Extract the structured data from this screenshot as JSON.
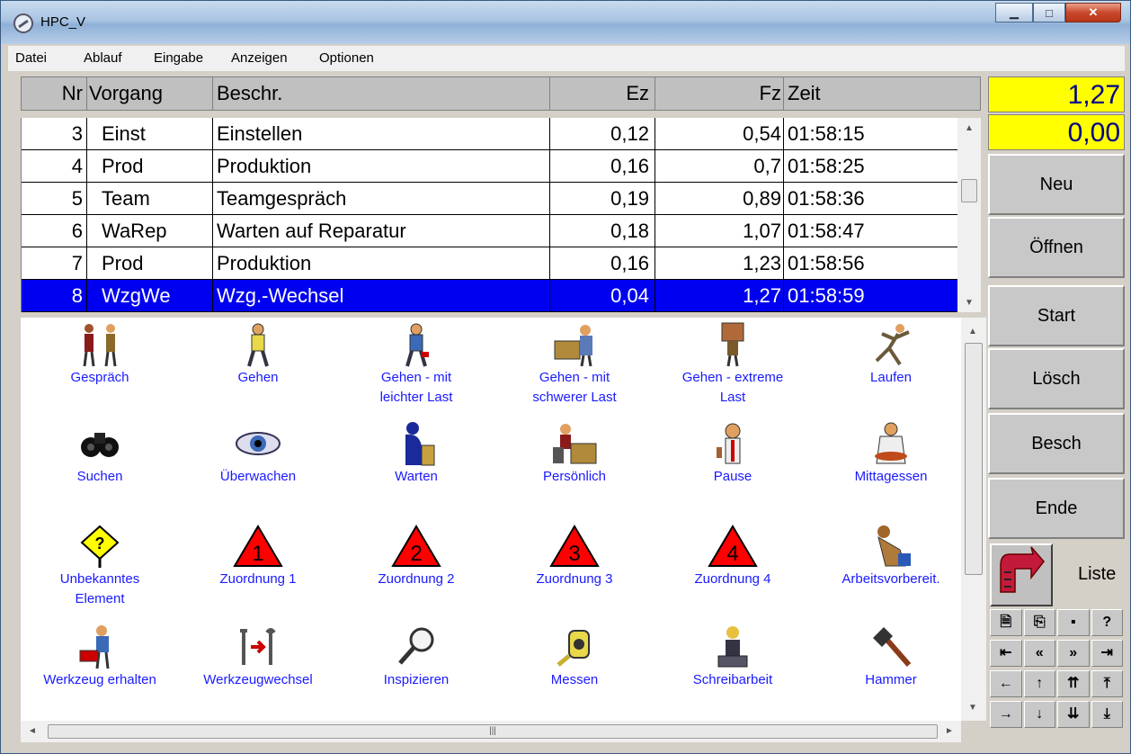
{
  "window": {
    "title": "HPC_V"
  },
  "menu": [
    "Datei",
    "Ablauf",
    "Eingabe",
    "Anzeigen",
    "Optionen"
  ],
  "table": {
    "headers": {
      "nr": "Nr",
      "vorgang": "Vorgang",
      "beschr": "Beschr.",
      "ez": "Ez",
      "fz": "Fz",
      "zeit": "Zeit"
    },
    "rows": [
      {
        "nr": "3",
        "vorgang": "Einst",
        "beschr": "Einstellen",
        "ez": "0,12",
        "fz": "0,54",
        "zeit": "01:58:15"
      },
      {
        "nr": "4",
        "vorgang": "Prod",
        "beschr": "Produktion",
        "ez": "0,16",
        "fz": "0,7",
        "zeit": "01:58:25"
      },
      {
        "nr": "5",
        "vorgang": "Team",
        "beschr": "Teamgespräch",
        "ez": "0,19",
        "fz": "0,89",
        "zeit": "01:58:36"
      },
      {
        "nr": "6",
        "vorgang": "WaRep",
        "beschr": "Warten auf Reparatur",
        "ez": "0,18",
        "fz": "1,07",
        "zeit": "01:58:47"
      },
      {
        "nr": "7",
        "vorgang": "Prod",
        "beschr": "Produktion",
        "ez": "0,16",
        "fz": "1,23",
        "zeit": "01:58:56"
      },
      {
        "nr": "8",
        "vorgang": "WzgWe",
        "beschr": "Wzg.-Wechsel",
        "ez": "0,04",
        "fz": "1,27",
        "zeit": "01:58:59",
        "selected": true
      }
    ]
  },
  "icons": [
    {
      "label1": "Gespräch",
      "label2": "",
      "icon": "conversation-icon"
    },
    {
      "label1": "Gehen",
      "label2": "",
      "icon": "walking-icon"
    },
    {
      "label1": "Gehen - mit",
      "label2": "leichter Last",
      "icon": "walking-light-load-icon"
    },
    {
      "label1": "Gehen - mit",
      "label2": "schwerer Last",
      "icon": "walking-heavy-load-icon"
    },
    {
      "label1": "Gehen - extreme",
      "label2": "Last",
      "icon": "walking-extreme-load-icon"
    },
    {
      "label1": "Laufen",
      "label2": "",
      "icon": "running-icon"
    },
    {
      "label1": "Suchen",
      "label2": "",
      "icon": "binoculars-icon"
    },
    {
      "label1": "Überwachen",
      "label2": "",
      "icon": "eye-icon"
    },
    {
      "label1": "Warten",
      "label2": "",
      "icon": "waiting-icon"
    },
    {
      "label1": "Persönlich",
      "label2": "",
      "icon": "personal-desk-icon"
    },
    {
      "label1": "Pause",
      "label2": "",
      "icon": "pause-icon"
    },
    {
      "label1": "Mittagessen",
      "label2": "",
      "icon": "lunch-icon"
    },
    {
      "label1": "Unbekanntes",
      "label2": "Element",
      "icon": "unknown-sign-icon"
    },
    {
      "label1": "Zuordnung 1",
      "label2": "",
      "icon": "triangle-1-icon",
      "num": "1"
    },
    {
      "label1": "Zuordnung 2",
      "label2": "",
      "icon": "triangle-2-icon",
      "num": "2"
    },
    {
      "label1": "Zuordnung 3",
      "label2": "",
      "icon": "triangle-3-icon",
      "num": "3"
    },
    {
      "label1": "Zuordnung 4",
      "label2": "",
      "icon": "triangle-4-icon",
      "num": "4"
    },
    {
      "label1": "Arbeitsvorbereit.",
      "label2": "",
      "icon": "work-preparation-icon"
    },
    {
      "label1": "Werkzeug erhalten",
      "label2": "",
      "icon": "toolbox-icon"
    },
    {
      "label1": "Werkzeugwechsel",
      "label2": "",
      "icon": "tool-change-icon"
    },
    {
      "label1": "Inspizieren",
      "label2": "",
      "icon": "magnifier-icon"
    },
    {
      "label1": "Messen",
      "label2": "",
      "icon": "tape-measure-icon"
    },
    {
      "label1": "Schreibarbeit",
      "label2": "",
      "icon": "writing-icon"
    },
    {
      "label1": "Hammer",
      "label2": "",
      "icon": "hammer-icon"
    }
  ],
  "display": {
    "value1": "1,27",
    "value2": "0,00"
  },
  "buttons": {
    "neu": "Neu",
    "oeffnen": "Öffnen",
    "start": "Start",
    "loesch": "Lösch",
    "besch": "Besch",
    "ende": "Ende",
    "liste": "Liste"
  },
  "colors": {
    "selection": "#0000f0",
    "display_bg": "#ffff00",
    "icon_label": "#1a1aff",
    "triangle": "#ff0000"
  }
}
